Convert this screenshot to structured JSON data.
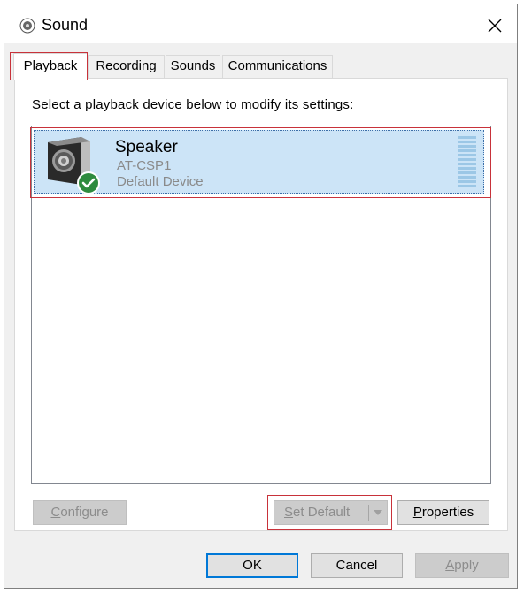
{
  "window": {
    "title": "Sound",
    "close_glyph": "✕",
    "icon": "speaker-icon"
  },
  "tabs": [
    {
      "label": "Playback",
      "active": true
    },
    {
      "label": "Recording",
      "active": false
    },
    {
      "label": "Sounds",
      "active": false
    },
    {
      "label": "Communications",
      "active": false
    }
  ],
  "playback": {
    "instruction": "Select a playback device below to modify its settings:",
    "devices": [
      {
        "name": "Speaker",
        "model": "AT-CSP1",
        "status": "Default Device",
        "icon": "speaker-device-icon",
        "badge": "checkmark-icon",
        "selected": true
      }
    ],
    "buttons": {
      "configure": {
        "prefix": "",
        "accel": "C",
        "suffix": "onfigure",
        "enabled": false
      },
      "set_default": {
        "prefix": "",
        "accel": "S",
        "suffix": "et Default",
        "enabled": false
      },
      "properties": {
        "prefix": "",
        "accel": "P",
        "suffix": "roperties",
        "enabled": true
      }
    }
  },
  "footer": {
    "ok": "OK",
    "cancel": "Cancel",
    "apply": {
      "prefix": "",
      "accel": "A",
      "suffix": "pply",
      "enabled": false
    }
  },
  "colors": {
    "accent": "#0078d7",
    "selection": "#cce4f7",
    "highlight_box": "#c8323a",
    "badge_green": "#2e8b3e"
  }
}
